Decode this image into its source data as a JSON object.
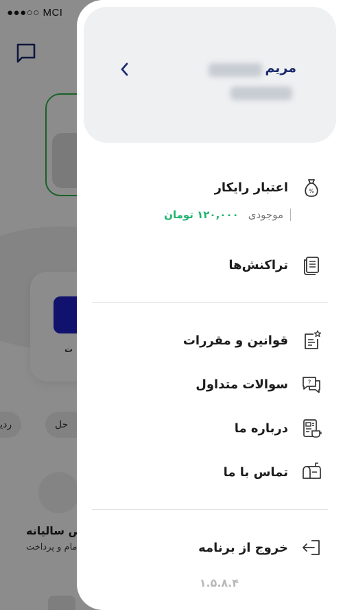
{
  "status_bar": {
    "signal_text": "●●●○○ MCI"
  },
  "background": {
    "card_text": "ت",
    "chips": [
      "ردیا",
      "حل"
    ],
    "section_title": "ص سالیانه",
    "section_subtitle": "مام و پرداخت"
  },
  "drawer": {
    "profile": {
      "name": "مریم"
    },
    "menu": {
      "credit_label": "اعتبار رایکار",
      "balance_label": "موجودی",
      "balance_amount": "۱۲۰,۰۰۰ تومان",
      "transactions_label": "تراکنش‌ها",
      "terms_label": "قوانین و مقررات",
      "faq_label": "سوالات متداول",
      "about_label": "درباره ما",
      "contact_label": "تماس با ما",
      "logout_label": "خروج از برنامه"
    },
    "version": "۱.۵.۸.۴"
  },
  "colors": {
    "accent_navy": "#1c2a6e",
    "balance_green": "#1fb36e",
    "promo_green": "#2db34a",
    "card_blue": "#1f22c9"
  }
}
